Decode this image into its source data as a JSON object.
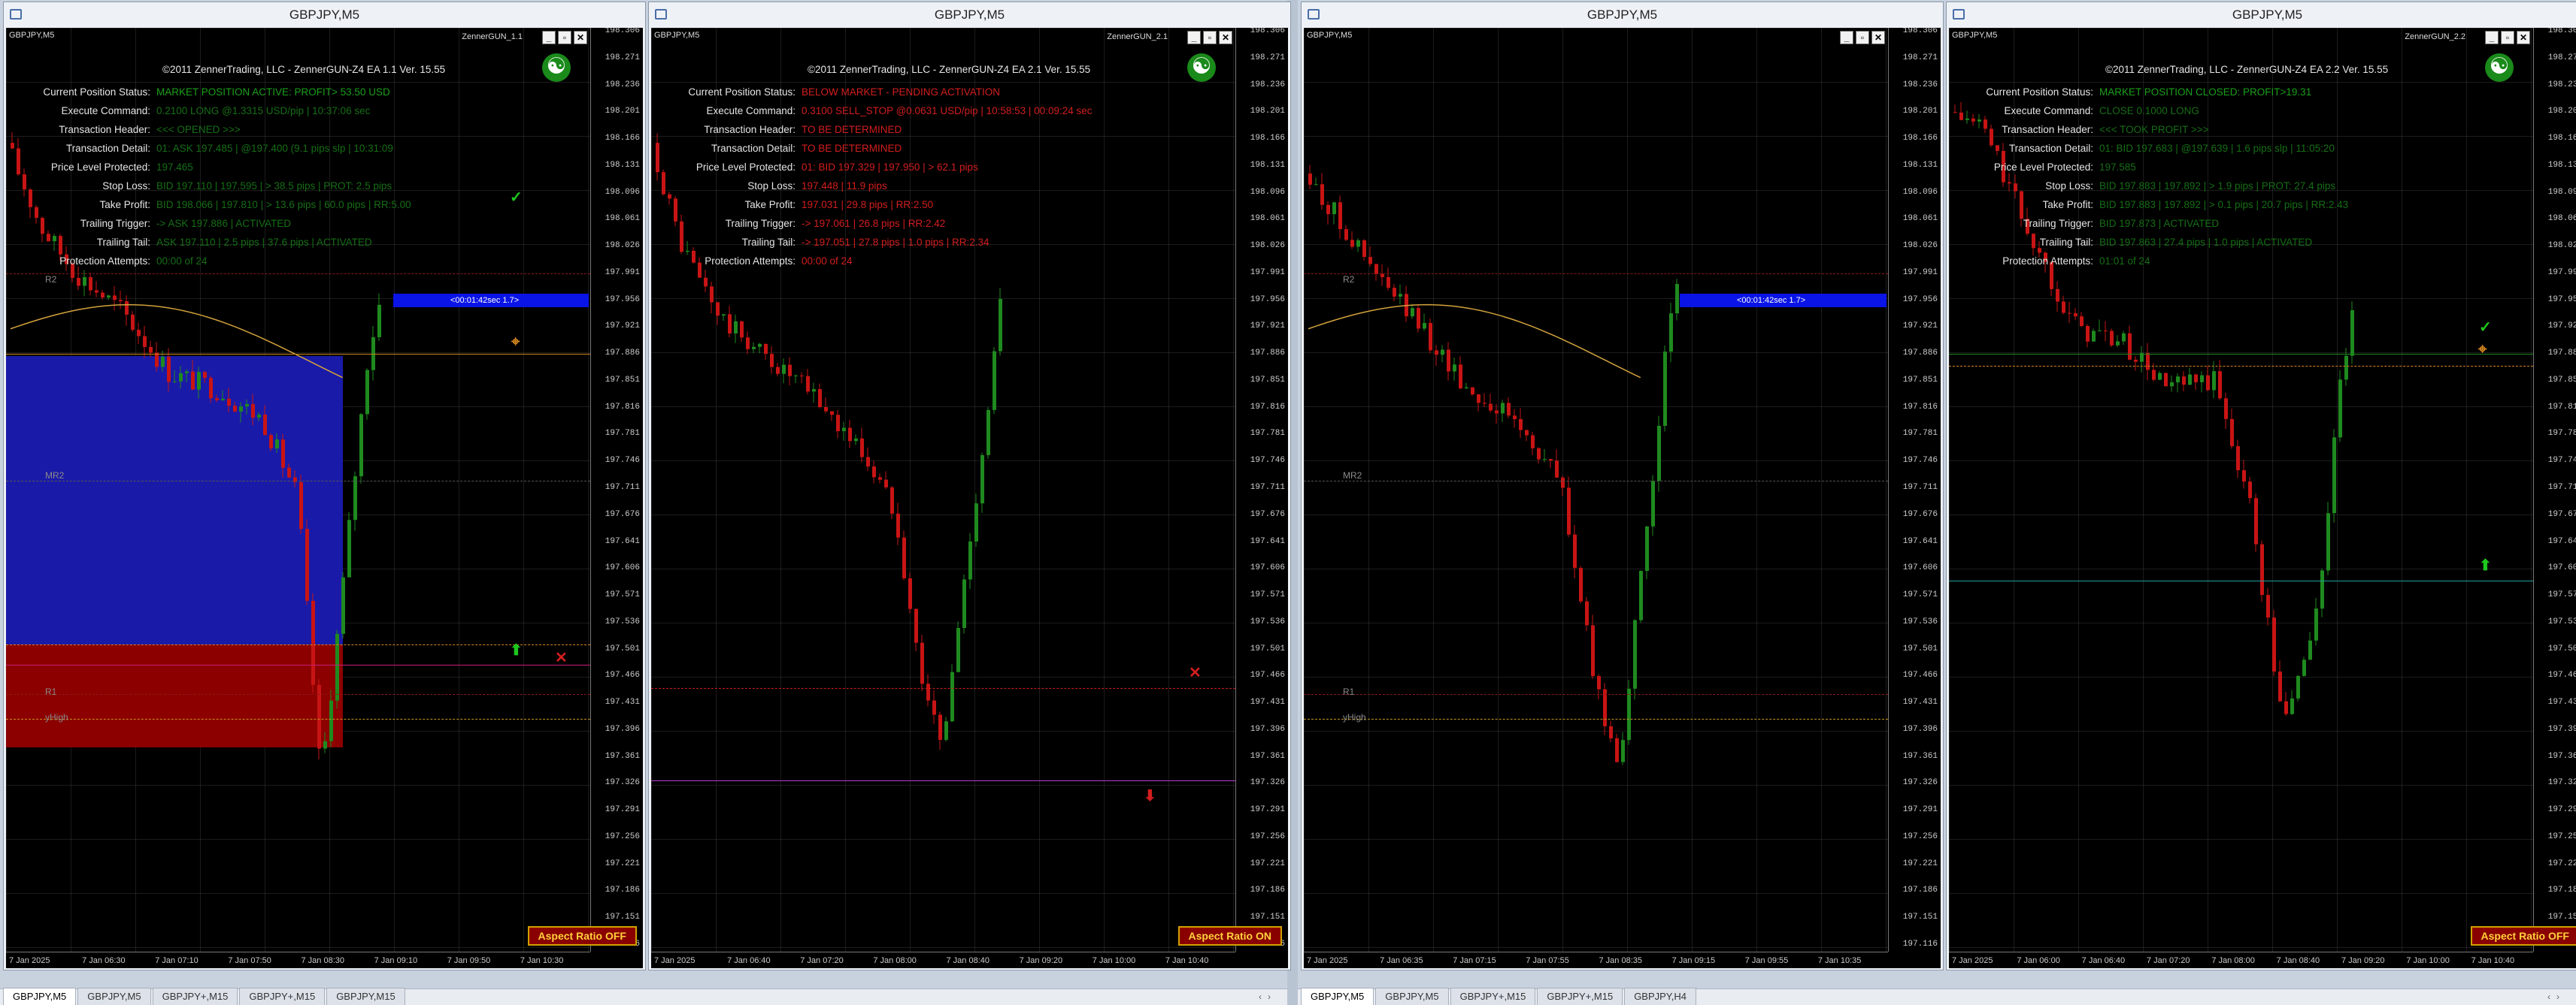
{
  "tabs": [
    {
      "label": "GBPJPY,M5",
      "active": true
    },
    {
      "label": "GBPJPY,M5",
      "active": false
    },
    {
      "label": "GBPJPY+,M15",
      "active": false
    },
    {
      "label": "GBPJPY+,M15",
      "active": false
    },
    {
      "label": "GBPJPY,M15",
      "active": false
    }
  ],
  "tabs_right": [
    {
      "label": "GBPJPY,M5",
      "active": true
    },
    {
      "label": "GBPJPY,M5",
      "active": false
    },
    {
      "label": "GBPJPY+,M15",
      "active": false
    },
    {
      "label": "GBPJPY+,M15",
      "active": false
    },
    {
      "label": "GBPJPY,H4",
      "active": false
    }
  ],
  "price_ticks": [
    "198.306",
    "198.271",
    "198.236",
    "198.201",
    "198.166",
    "198.131",
    "198.096",
    "198.061",
    "198.026",
    "197.991",
    "197.956",
    "197.921",
    "197.886",
    "197.851",
    "197.816",
    "197.781",
    "197.746",
    "197.711",
    "197.676",
    "197.641",
    "197.606",
    "197.571",
    "197.536",
    "197.501",
    "197.466",
    "197.431",
    "197.396",
    "197.361",
    "197.326",
    "197.291",
    "197.256",
    "197.221",
    "197.186",
    "197.151",
    "197.116"
  ],
  "labels": {
    "current_status": "Current Position Status:",
    "execute": "Execute Command:",
    "header": "Transaction Header:",
    "detail": "Transaction Detail:",
    "protected": "Price Level Protected:",
    "stop": "Stop Loss:",
    "take": "Take Profit:",
    "trigger": "Trailing Trigger:",
    "tail": "Trailing Tail:",
    "attempts": "Protection Attempts:",
    "aspect_off": "Aspect Ratio OFF",
    "aspect_on": "Aspect Ratio ON",
    "timer": "<00:01:42sec 1.7>"
  },
  "colors": {
    "green_value": "#1a9e1a",
    "red_value": "#d21e1e",
    "chart_bg": "#000000",
    "bull": "#1f8a1f",
    "bear": "#c81414",
    "ma": "#d2a23c"
  },
  "windows": [
    {
      "title": "GBPJPY,M5",
      "symbol": "GBPJPY,M5",
      "ea": "ZennerGUN_1.1",
      "copyright": "©2011 ZennerTrading, LLC - ZennerGUN-Z4 EA 1.1 Ver. 15.55",
      "status": "MARKET POSITION ACTIVE: PROFIT> 53.50 USD",
      "status_color": "green",
      "execute": "0.2100 LONG @1.3315 USD/pip | 10:37:06 sec",
      "header": "<<< OPENED >>>",
      "detail": "01: ASK 197.485 | @197.400 (9.1 pips slp | 10:31:09",
      "protected": "197.465",
      "stop": "BID 197.110 | 197.595 | > 38.5 pips | PROT: 2.5 pips",
      "take": "BID 198.066 | 197.810 | > 13.6 pips | 60.0 pips | RR:5.00",
      "trigger": "-> ASK 197.886 | ACTIVATED",
      "tail": "ASK 197.110 | 2.5 pips | 37.6 pips | ACTIVATED",
      "attempts": "00:00 of 24",
      "time_ticks": [
        "7 Jan 2025",
        "7 Jan 06:30",
        "7 Jan 07:10",
        "7 Jan 07:50",
        "7 Jan 08:30",
        "7 Jan 09:10",
        "7 Jan 09:50",
        "7 Jan 10:30"
      ],
      "aspect": "off",
      "levels": {
        "r2": "R2",
        "mr2": "MR2",
        "r1": "R1",
        "yhigh": "yHigh"
      }
    },
    {
      "title": "GBPJPY,M5",
      "symbol": "GBPJPY,M5",
      "ea": "ZennerGUN_2.1",
      "copyright": "©2011 ZennerTrading, LLC - ZennerGUN-Z4 EA 2.1 Ver. 15.55",
      "status": "BELOW MARKET - PENDING ACTIVATION",
      "status_color": "red",
      "execute": "0.3100 SELL_STOP @0.0631 USD/pip | 10:58:53 | 00:09:24 sec",
      "header": "TO BE DETERMINED",
      "detail": "TO BE DETERMINED",
      "protected": "01: BID 197.329 | 197.950 | > 62.1 pips",
      "stop": "197.448 | 11.9 pips",
      "take": "197.031 | 29.8 pips | RR:2.50",
      "trigger": "-> 197.061 | 26.8 pips | RR:2.42",
      "tail": "-> 197.051 | 27.8 pips | 1.0 pips | RR:2.34",
      "attempts": "00:00 of 24",
      "time_ticks": [
        "7 Jan 2025",
        "7 Jan 06:40",
        "7 Jan 07:20",
        "7 Jan 08:00",
        "7 Jan 08:40",
        "7 Jan 09:20",
        "7 Jan 10:00",
        "7 Jan 10:40"
      ],
      "aspect": "on",
      "levels": {}
    },
    {
      "title": "GBPJPY,M5",
      "symbol": "GBPJPY,M5",
      "ea": "",
      "copyright": "",
      "time_ticks": [
        "7 Jan 2025",
        "7 Jan 06:35",
        "7 Jan 07:15",
        "7 Jan 07:55",
        "7 Jan 08:35",
        "7 Jan 09:15",
        "7 Jan 09:55",
        "7 Jan 10:35"
      ],
      "aspect": "none",
      "levels": {
        "r2": "R2",
        "mr2": "MR2",
        "r1": "R1",
        "yhigh": "yHigh"
      }
    },
    {
      "title": "GBPJPY,M5",
      "symbol": "GBPJPY,M5",
      "ea": "ZennerGUN_2.2",
      "copyright": "©2011 ZennerTrading, LLC - ZennerGUN-Z4 EA 2.2 Ver. 15.55",
      "status": "MARKET POSITION CLOSED: PROFIT>19.31",
      "status_color": "green",
      "execute": "CLOSE 0.1000 LONG",
      "header": "<<< TOOK PROFIT >>>",
      "detail": "01: BID 197.683 | @197.639 | 1.6 pips slp | 11:05:20",
      "protected": "197.585",
      "stop": "BID 197.883 | 197.892 | > 1.9 pips | PROT: 27.4 pips",
      "take": "BID 197.883 | 197.892 | > 0.1 pips | 20.7 pips | RR:2.43",
      "trigger": "BID 197.873 | ACTIVATED",
      "tail": "BID 197.863 | 27.4 pips | 1.0 pips | ACTIVATED",
      "attempts": "01:01 of 24",
      "time_ticks": [
        "7 Jan 2025",
        "7 Jan 06:00",
        "7 Jan 06:40",
        "7 Jan 07:20",
        "7 Jan 08:00",
        "7 Jan 08:40",
        "7 Jan 09:20",
        "7 Jan 10:00",
        "7 Jan 10:40"
      ],
      "aspect": "off",
      "levels": {}
    }
  ]
}
